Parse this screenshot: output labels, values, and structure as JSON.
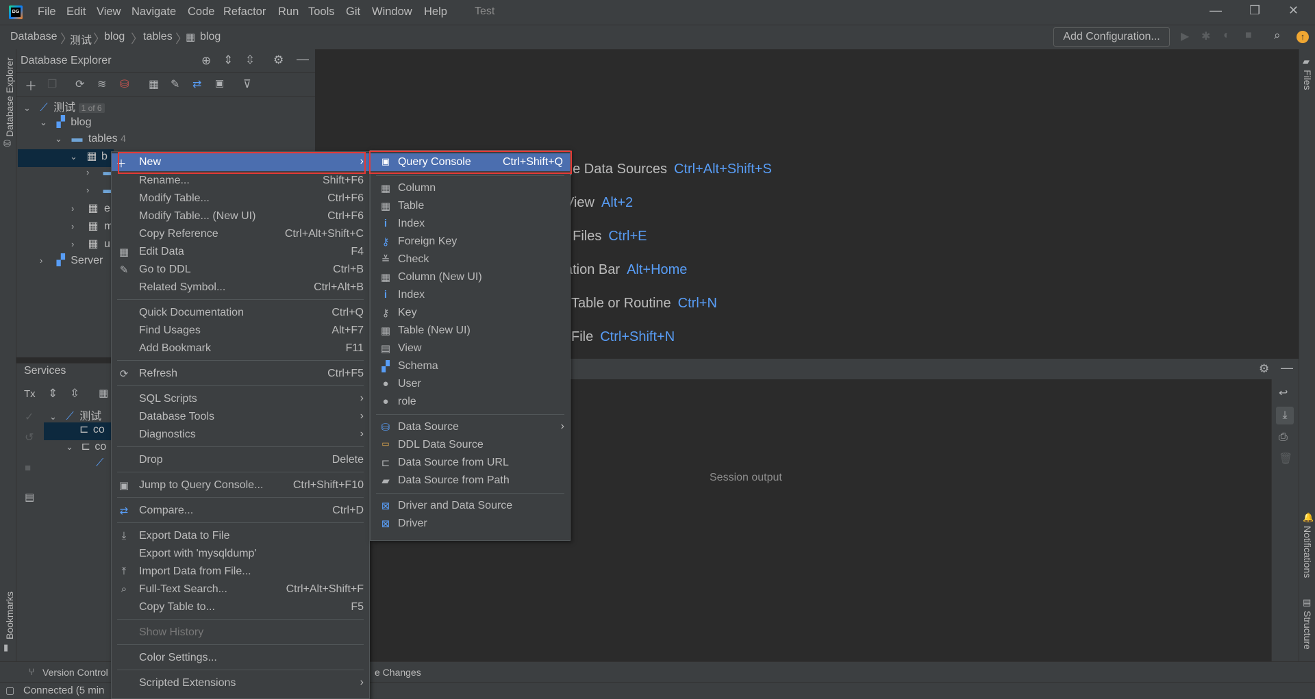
{
  "titlebar": {
    "menus": [
      "File",
      "Edit",
      "View",
      "Navigate",
      "Code",
      "Refactor",
      "Run",
      "Tools",
      "Git",
      "Window",
      "Help"
    ],
    "project": "Test"
  },
  "breadcrumb": [
    "Database",
    "测试",
    "blog",
    "tables",
    "blog"
  ],
  "toolbar": {
    "add_configuration": "Add Configuration..."
  },
  "left_stripe": {
    "database_explorer": "Database Explorer",
    "bookmarks": "Bookmarks"
  },
  "right_stripe": {
    "files": "Files",
    "notifications": "Notifications",
    "structure": "Structure"
  },
  "db_explorer": {
    "title": "Database Explorer",
    "tree": {
      "root_label": "测试",
      "root_badge": "1 of 6",
      "schema": "blog",
      "tables_label": "tables",
      "tables_count": "4",
      "selected_prefix": "b",
      "row_e": "e",
      "row_m": "m",
      "row_u": "u",
      "server": "Server"
    }
  },
  "services": {
    "title": "Services",
    "tx": "Tx",
    "root": "测试",
    "con1": "co",
    "con2": "co"
  },
  "editor_hints": [
    {
      "label": "ge Data Sources",
      "key": "Ctrl+Alt+Shift+S"
    },
    {
      "label": "View",
      "key": "Alt+2"
    },
    {
      "label": "t Files",
      "key": "Ctrl+E"
    },
    {
      "label": "ation Bar",
      "key": "Alt+Home"
    },
    {
      "label": "Table or Routine",
      "key": "Ctrl+N"
    },
    {
      "label": "File",
      "key": "Ctrl+Shift+N"
    }
  ],
  "output": {
    "session_output": "Session output"
  },
  "bottom": {
    "version_control": "Version Control",
    "changes": "e Changes",
    "status": "Connected (5 min"
  },
  "context_menu": {
    "new": "New",
    "rename": {
      "label": "Rename...",
      "shortcut": "Shift+F6"
    },
    "modify_table": {
      "label": "Modify Table...",
      "shortcut": "Ctrl+F6"
    },
    "modify_table_new": {
      "label": "Modify Table... (New UI)",
      "shortcut": "Ctrl+F6"
    },
    "copy_reference": {
      "label": "Copy Reference",
      "shortcut": "Ctrl+Alt+Shift+C"
    },
    "edit_data": {
      "label": "Edit Data",
      "shortcut": "F4"
    },
    "go_to_ddl": {
      "label": "Go to DDL",
      "shortcut": "Ctrl+B"
    },
    "related_symbol": {
      "label": "Related Symbol...",
      "shortcut": "Ctrl+Alt+B"
    },
    "quick_doc": {
      "label": "Quick Documentation",
      "shortcut": "Ctrl+Q"
    },
    "find_usages": {
      "label": "Find Usages",
      "shortcut": "Alt+F7"
    },
    "add_bookmark": {
      "label": "Add Bookmark",
      "shortcut": "F11"
    },
    "refresh": {
      "label": "Refresh",
      "shortcut": "Ctrl+F5"
    },
    "sql_scripts": "SQL Scripts",
    "database_tools": "Database Tools",
    "diagnostics": "Diagnostics",
    "drop": {
      "label": "Drop",
      "shortcut": "Delete"
    },
    "jump_query_console": {
      "label": "Jump to Query Console...",
      "shortcut": "Ctrl+Shift+F10"
    },
    "compare": {
      "label": "Compare...",
      "shortcut": "Ctrl+D"
    },
    "export_file": "Export Data to File",
    "export_mysqldump": "Export with 'mysqldump'",
    "import_file": "Import Data from File...",
    "fulltext": {
      "label": "Full-Text Search...",
      "shortcut": "Ctrl+Alt+Shift+F"
    },
    "copy_table": {
      "label": "Copy Table to...",
      "shortcut": "F5"
    },
    "show_history": "Show History",
    "color_settings": "Color Settings...",
    "scripted_ext": "Scripted Extensions"
  },
  "new_submenu": {
    "query_console": {
      "label": "Query Console",
      "shortcut": "Ctrl+Shift+Q"
    },
    "column": "Column",
    "table": "Table",
    "index": "Index",
    "foreign_key": "Foreign Key",
    "check": "Check",
    "column_new": "Column (New UI)",
    "index2": "Index",
    "key": "Key",
    "table_new": "Table (New UI)",
    "view": "View",
    "schema": "Schema",
    "user": "User",
    "role": "role",
    "data_source": "Data Source",
    "ddl_data_source": "DDL Data Source",
    "ds_url": "Data Source from URL",
    "ds_path": "Data Source from Path",
    "driver_ds": "Driver and Data Source",
    "driver": "Driver"
  }
}
